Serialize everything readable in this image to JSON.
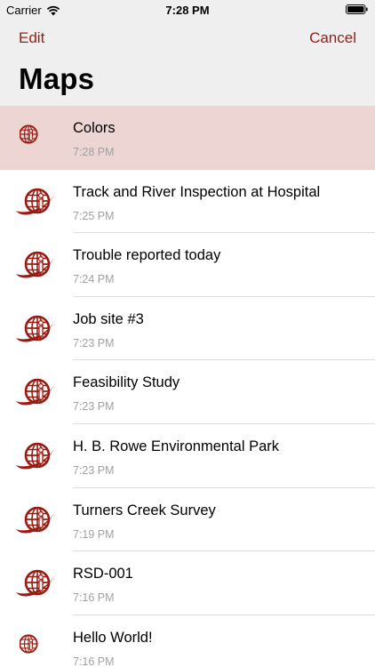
{
  "status_bar": {
    "carrier": "Carrier",
    "time": "7:28 PM",
    "wifi_icon": "wifi-icon",
    "battery_icon": "battery-icon"
  },
  "nav": {
    "edit_label": "Edit",
    "cancel_label": "Cancel",
    "title": "Maps"
  },
  "colors": {
    "accent": "#9a1b12",
    "selected_row": "#ecd5d3",
    "nav_background": "#efefef",
    "subtitle": "#a0a0a0"
  },
  "maps": [
    {
      "title": "Colors",
      "time": "7:28 PM",
      "selected": true,
      "icon": "globe-info-icon"
    },
    {
      "title": "Track and River Inspection at Hospital",
      "time": "7:25 PM",
      "icon": "globe-orbit-info-icon"
    },
    {
      "title": "Trouble reported today",
      "time": "7:24 PM",
      "icon": "globe-orbit-info-icon"
    },
    {
      "title": "Job site #3",
      "time": "7:23 PM",
      "icon": "globe-orbit-info-icon"
    },
    {
      "title": "Feasibility Study",
      "time": "7:23 PM",
      "icon": "globe-orbit-info-icon"
    },
    {
      "title": "H. B. Rowe Environmental Park",
      "time": "7:23 PM",
      "icon": "globe-orbit-info-icon"
    },
    {
      "title": "Turners Creek Survey",
      "time": "7:19 PM",
      "icon": "globe-orbit-info-icon"
    },
    {
      "title": "RSD-001",
      "time": "7:16 PM",
      "icon": "globe-orbit-info-icon"
    },
    {
      "title": "Hello World!",
      "time": "7:16 PM",
      "icon": "globe-info-icon"
    }
  ]
}
